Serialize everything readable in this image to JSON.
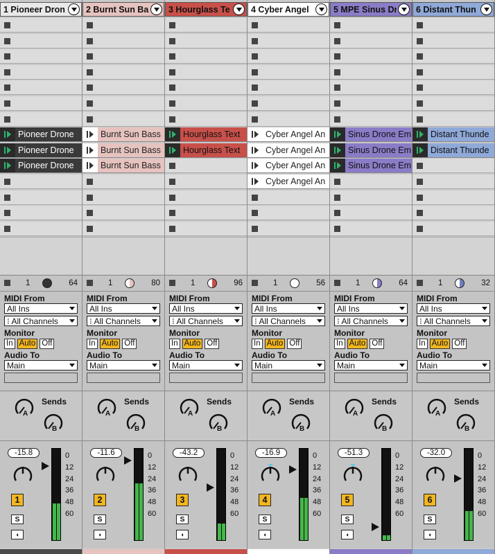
{
  "tracks": [
    {
      "id": "t1",
      "name": "1 Pioneer Dron",
      "color": "#e9e9e9",
      "clip_color": "#3a3a3a",
      "clip_text": "#ffffff",
      "clips": [
        "Pioneer Drone",
        "Pioneer Drone",
        "Pioneer Drone"
      ],
      "io_num": "1",
      "io_val": "64",
      "knob_color": "#333",
      "midi_from": "All Ins",
      "channels": "All Channels",
      "monitor": [
        "In",
        "Auto",
        "Off"
      ],
      "audio_to": "Main",
      "vol": "-15.8",
      "num": "1",
      "solo": "S",
      "arm": "◖",
      "footer": "#4a4a4a",
      "meter": [
        0.4,
        0.4
      ],
      "fader": 0.8
    },
    {
      "id": "t2",
      "name": "2 Burnt Sun Ba",
      "color": "#e6c3bf",
      "clip_color": "#e6c3bf",
      "clip_text": "#222",
      "clips": [
        "Burnt Sun Bass",
        "Burnt Sun Bass",
        "Burnt Sun Bass"
      ],
      "io_num": "1",
      "io_val": "80",
      "knob_color": "#e6c3bf",
      "midi_from": "All Ins",
      "channels": "All Channels",
      "monitor": [
        "In",
        "Auto",
        "Off"
      ],
      "audio_to": "Main",
      "vol": "-11.6",
      "num": "2",
      "solo": "S",
      "arm": "◖",
      "footer": "#e6c3bf",
      "meter": [
        0.62,
        0.62
      ],
      "fader": 0.86
    },
    {
      "id": "t3",
      "name": "3 Hourglass Te",
      "color": "#c8504a",
      "clip_color": "#c8504a",
      "clip_text": "#111",
      "clips": [
        "Hourglass Text",
        "Hourglass Text"
      ],
      "io_num": "1",
      "io_val": "96",
      "knob_color": "#c8504a",
      "midi_from": "All Ins",
      "channels": "All Channels",
      "monitor": [
        "In",
        "Auto",
        "Off"
      ],
      "audio_to": "Main",
      "vol": "-43.2",
      "num": "3",
      "solo": "S",
      "arm": "◖",
      "footer": "#c8504a",
      "meter": [
        0.18,
        0.18
      ],
      "fader": 0.56
    },
    {
      "id": "t4",
      "name": "4 Cyber Angel",
      "color": "#ffffff",
      "clip_color": "#ffffff",
      "clip_text": "#222",
      "clips": [
        "Cyber Angel An",
        "Cyber Angel An",
        "Cyber Angel An",
        "Cyber Angel An"
      ],
      "io_num": "1",
      "io_val": "56",
      "knob_color": "#fff",
      "midi_from": "All Ins",
      "channels": "All Channels",
      "monitor": [
        "In",
        "Auto",
        "Off"
      ],
      "audio_to": "Main",
      "vol": "-16.9",
      "num": "4",
      "solo": "S",
      "arm": "◖",
      "footer": "#ffffff",
      "meter": [
        0.46,
        0.46
      ],
      "fader": 0.76
    },
    {
      "id": "t5",
      "name": "5 MPE Sinus Dr",
      "color": "#8b7cc7",
      "clip_color": "#8b7cc7",
      "clip_text": "#111",
      "clips": [
        "Sinus Drone Em",
        "Sinus Drone Em",
        "Sinus Drone Em"
      ],
      "io_num": "1",
      "io_val": "64",
      "knob_color": "#8b7cc7",
      "midi_from": "All Ins",
      "channels": "All Channels",
      "monitor": [
        "In",
        "Auto",
        "Off"
      ],
      "audio_to": "Main",
      "vol": "-51.3",
      "num": "5",
      "solo": "S",
      "arm": "◖",
      "footer": "#8b7cc7",
      "meter": [
        0.05,
        0.05
      ],
      "fader": 0.12
    },
    {
      "id": "t6",
      "name": "6 Distant Thun",
      "color": "#8fa9d8",
      "clip_color": "#8fa9d8",
      "clip_text": "#111",
      "clips": [
        "Distant Thunde",
        "Distant Thunde"
      ],
      "io_num": "1",
      "io_val": "32",
      "knob_color": "#6f7fc0",
      "midi_from": "All Ins",
      "channels": "All Channels",
      "monitor": [
        "In",
        "Auto",
        "Off"
      ],
      "audio_to": "Main",
      "vol": "-32.0",
      "num": "6",
      "solo": "S",
      "arm": "◖",
      "footer": "#8fa9d8",
      "meter": [
        0.32,
        0.32
      ],
      "fader": 0.66
    }
  ],
  "labels": {
    "midi_from": "MIDI From",
    "monitor": "Monitor",
    "audio_to": "Audio To",
    "sends": "Sends",
    "send_a": "A",
    "send_b": "B"
  },
  "meter_scale": [
    "0",
    "12",
    "24",
    "36",
    "48",
    "60"
  ]
}
